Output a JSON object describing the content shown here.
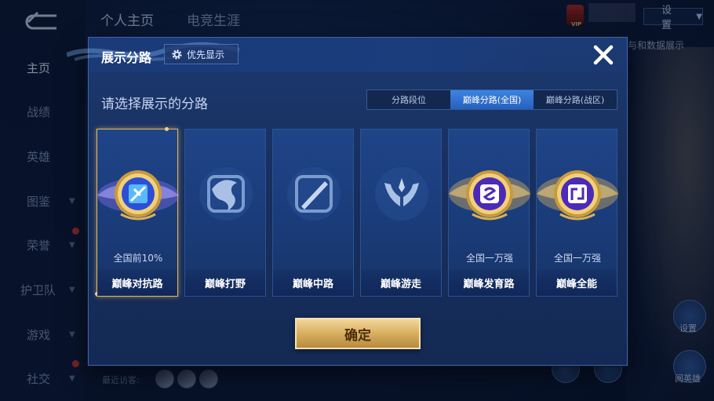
{
  "background": {
    "top_tabs": [
      "个人主页",
      "电竞生涯"
    ],
    "settings_label": "设置",
    "vip_label": "VIP",
    "data_show_label": "与和数据展示",
    "nav_items": [
      {
        "label": "主页",
        "active": true
      },
      {
        "label": "战绩"
      },
      {
        "label": "英雄"
      },
      {
        "label": "图鉴"
      },
      {
        "label": "荣誉"
      },
      {
        "label": "护卫队"
      },
      {
        "label": "游戏"
      },
      {
        "label": "社交"
      }
    ],
    "recent_visitors_label": "最近访客:",
    "side_buttons": [
      "设置",
      "阅英雄"
    ]
  },
  "dialog": {
    "title": "展示分路",
    "priority_button": "优先显示",
    "close_icon": "close-icon",
    "subtitle": "请选择展示的分路",
    "segments": [
      {
        "label": "分路段位",
        "active": false
      },
      {
        "label": "巅峰分路(全国)",
        "active": true
      },
      {
        "label": "巅峰分路(战区)",
        "active": false
      }
    ],
    "cards": [
      {
        "name": "巅峰对抗路",
        "rank": "全国前10%",
        "icon": "sword-badge-icon",
        "lit": true,
        "selected": true
      },
      {
        "name": "巅峰打野",
        "rank": "",
        "icon": "dragon-badge-icon",
        "lit": false,
        "selected": false
      },
      {
        "name": "巅峰中路",
        "rank": "",
        "icon": "staff-badge-icon",
        "lit": false,
        "selected": false
      },
      {
        "name": "巅峰游走",
        "rank": "",
        "icon": "wings-badge-icon",
        "lit": false,
        "selected": false
      },
      {
        "name": "巅峰发育路",
        "rank": "全国一万强",
        "icon": "arrow-badge-icon",
        "lit": true,
        "selected": false
      },
      {
        "name": "巅峰全能",
        "rank": "全国一万强",
        "icon": "allround-badge-icon",
        "lit": true,
        "selected": false
      }
    ],
    "confirm_label": "确定",
    "colors": {
      "accent_gold": "#e7b95c",
      "segment_active": "#2f6fd0",
      "dialog_bg": "#18305f"
    }
  }
}
